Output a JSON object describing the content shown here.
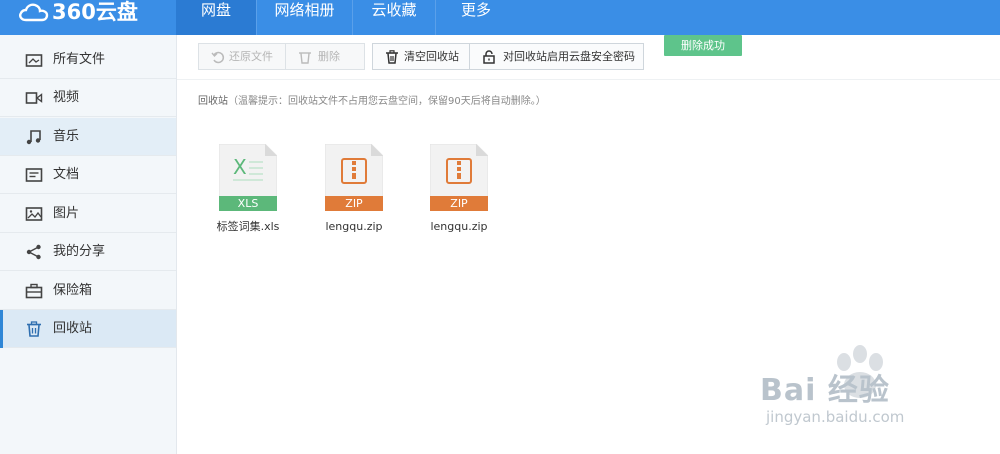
{
  "app": {
    "logo_text": "360云盘",
    "brand_color": "#3a8ee6"
  },
  "nav": {
    "items": [
      {
        "label": "网盘",
        "active": true
      },
      {
        "label": "网络相册",
        "active": false
      },
      {
        "label": "云收藏",
        "active": false
      },
      {
        "label": "更多",
        "active": false
      }
    ]
  },
  "sidebar": {
    "items": [
      {
        "label": "所有文件",
        "icon": "folder-icon"
      },
      {
        "label": "视频",
        "icon": "video-icon"
      },
      {
        "label": "音乐",
        "icon": "music-icon"
      },
      {
        "label": "文档",
        "icon": "document-icon"
      },
      {
        "label": "图片",
        "icon": "image-icon"
      },
      {
        "label": "我的分享",
        "icon": "share-icon"
      },
      {
        "label": "保险箱",
        "icon": "safe-icon"
      },
      {
        "label": "回收站",
        "icon": "trash-icon"
      }
    ]
  },
  "toolbar": {
    "restore_label": "还原文件",
    "delete_label": "删除",
    "empty_label": "清空回收站",
    "password_label": "对回收站启用云盘安全密码"
  },
  "toast": {
    "text": "删除成功",
    "color": "#5ec48b"
  },
  "breadcrumb": {
    "location": "回收站",
    "tip": "（温馨提示：回收站文件不占用您云盘空间，保留90天后将自动删除。）"
  },
  "files": [
    {
      "name": "标签词集.xls",
      "type": "XLS",
      "color": "#5cb87a"
    },
    {
      "name": "lengqu.zip",
      "type": "ZIP",
      "color": "#e07b39"
    },
    {
      "name": "lengqu.zip",
      "type": "ZIP",
      "color": "#e07b39"
    }
  ],
  "watermark": {
    "text": "Bai 经验",
    "url": "jingyan.baidu.com"
  }
}
